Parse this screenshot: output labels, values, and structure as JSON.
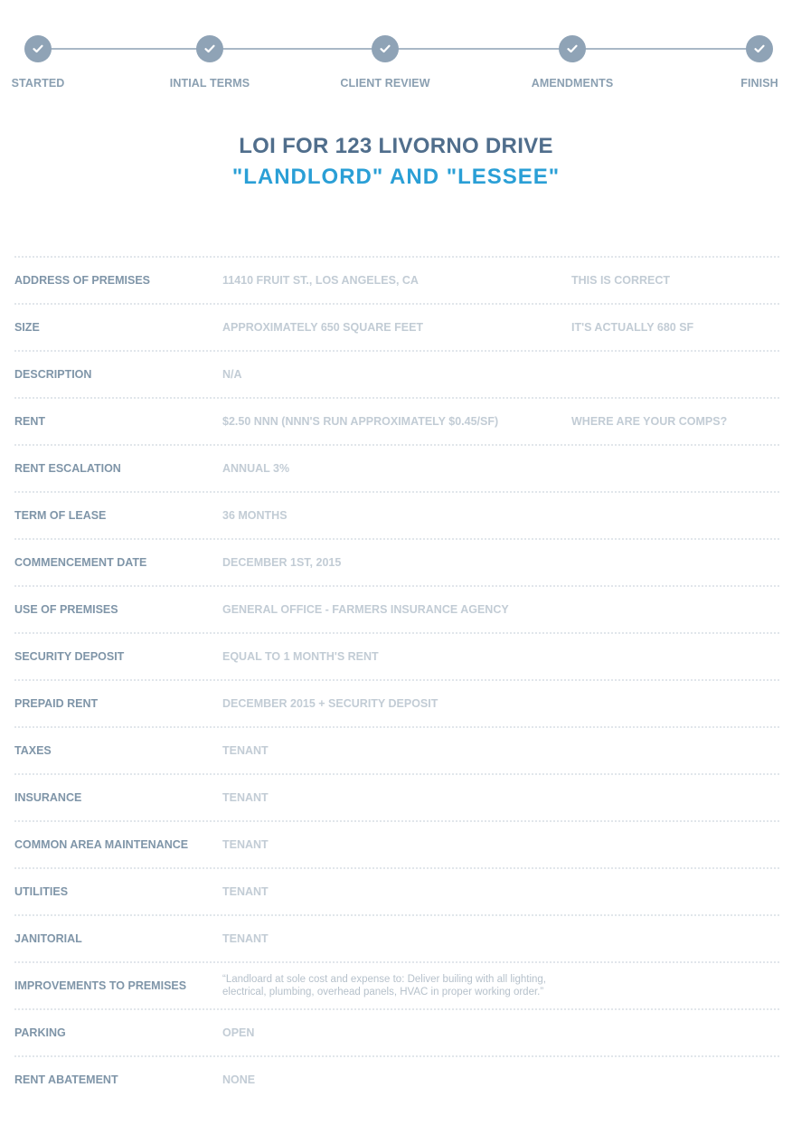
{
  "stepper": {
    "steps": [
      {
        "label": "STARTED",
        "icon": "check-icon"
      },
      {
        "label": "INTIAL TERMS",
        "icon": "check-icon"
      },
      {
        "label": "CLIENT REVIEW",
        "icon": "check-icon"
      },
      {
        "label": "AMENDMENTS",
        "icon": "check-icon"
      },
      {
        "label": "FINISH",
        "icon": "check-icon"
      }
    ]
  },
  "heading": {
    "title": "LOI FOR 123 LIVORNO DRIVE",
    "subtitle": "\"LANDLORD\" AND \"LESSEE\""
  },
  "terms": {
    "rows": [
      {
        "label": "ADDRESS OF PREMISES",
        "value": "11410 FRUIT ST., LOS ANGELES, CA",
        "note": "THIS IS CORRECT"
      },
      {
        "label": "SIZE",
        "value": "APPROXIMATELY 650 SQUARE FEET",
        "note": "IT'S ACTUALLY 680 SF"
      },
      {
        "label": "DESCRIPTION",
        "value": "N/A",
        "note": ""
      },
      {
        "label": "RENT",
        "value": "$2.50 NNN (NNN'S RUN APPROXIMATELY $0.45/SF)",
        "note": "WHERE ARE YOUR COMPS?"
      },
      {
        "label": "RENT ESCALATION",
        "value": "ANNUAL 3%",
        "note": ""
      },
      {
        "label": "TERM OF LEASE",
        "value": "36 MONTHS",
        "note": ""
      },
      {
        "label": "COMMENCEMENT DATE",
        "value": "DECEMBER 1ST, 2015",
        "note": ""
      },
      {
        "label": "USE OF PREMISES",
        "value": "GENERAL OFFICE - FARMERS INSURANCE AGENCY",
        "note": ""
      },
      {
        "label": "SECURITY DEPOSIT",
        "value": "EQUAL TO 1 MONTH'S RENT",
        "note": ""
      },
      {
        "label": "PREPAID RENT",
        "value": "DECEMBER 2015 + SECURITY DEPOSIT",
        "note": ""
      },
      {
        "label": "TAXES",
        "value": "TENANT",
        "note": ""
      },
      {
        "label": "INSURANCE",
        "value": "TENANT",
        "note": ""
      },
      {
        "label": "COMMON AREA MAINTENANCE",
        "value": "TENANT",
        "note": ""
      },
      {
        "label": "UTILITIES",
        "value": "TENANT",
        "note": ""
      },
      {
        "label": "JANITORIAL",
        "value": "TENANT",
        "note": ""
      },
      {
        "label": "IMPROVEMENTS TO PREMISES",
        "value": "“Landloard at sole cost and expense to: Deliver builing with all lighting, electrical, plumbing, overhead panels, HVAC in proper working order.”",
        "note": ""
      },
      {
        "label": "PARKING",
        "value": "OPEN",
        "note": ""
      },
      {
        "label": "RENT ABATEMENT",
        "value": "NONE",
        "note": ""
      }
    ]
  }
}
